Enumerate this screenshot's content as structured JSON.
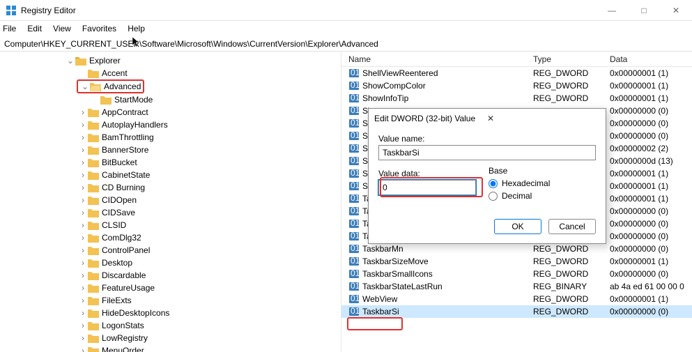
{
  "window": {
    "title": "Registry Editor",
    "controls": {
      "min": "—",
      "max": "□",
      "close": "✕"
    }
  },
  "menu": {
    "file": "File",
    "edit": "Edit",
    "view": "View",
    "favorites": "Favorites",
    "help": "Help"
  },
  "address": "Computer\\HKEY_CURRENT_USER\\Software\\Microsoft\\Windows\\CurrentVersion\\Explorer\\Advanced",
  "tree": {
    "root": "Explorer",
    "accent": "Accent",
    "advanced": "Advanced",
    "startmode": "StartMode",
    "items": [
      "AppContract",
      "AutoplayHandlers",
      "BamThrottling",
      "BannerStore",
      "BitBucket",
      "CabinetState",
      "CD Burning",
      "CIDOpen",
      "CIDSave",
      "CLSID",
      "ComDlg32",
      "ControlPanel",
      "Desktop",
      "Discardable",
      "FeatureUsage",
      "FileExts",
      "HideDesktopIcons",
      "LogonStats",
      "LowRegistry",
      "MenuOrder"
    ]
  },
  "columns": {
    "name": "Name",
    "type": "Type",
    "data": "Data"
  },
  "rows": [
    {
      "n": "ShellViewReentered",
      "t": "REG_DWORD",
      "d": "0x00000001 (1)"
    },
    {
      "n": "ShowCompColor",
      "t": "REG_DWORD",
      "d": "0x00000001 (1)"
    },
    {
      "n": "ShowInfoTip",
      "t": "REG_DWORD",
      "d": "0x00000001 (1)"
    },
    {
      "n": "Sho",
      "t": "",
      "d": "0x00000000 (0)"
    },
    {
      "n": "Sho",
      "t": "",
      "d": "0x00000000 (0)"
    },
    {
      "n": "Sho",
      "t": "",
      "d": "0x00000000 (0)"
    },
    {
      "n": "Start",
      "t": "",
      "d": "0x00000002 (2)"
    },
    {
      "n": "Start",
      "t": "",
      "d": "0x0000000d (13)"
    },
    {
      "n": "Start",
      "t": "",
      "d": "0x00000001 (1)"
    },
    {
      "n": "Start",
      "t": "",
      "d": "0x00000001 (1)"
    },
    {
      "n": "Task",
      "t": "",
      "d": "0x00000001 (1)"
    },
    {
      "n": "Task",
      "t": "",
      "d": "0x00000000 (0)"
    },
    {
      "n": "Task",
      "t": "",
      "d": "0x00000000 (0)"
    },
    {
      "n": "TaskbarGlomLevel",
      "t": "REG_DWORD",
      "d": "0x00000000 (0)"
    },
    {
      "n": "TaskbarMn",
      "t": "REG_DWORD",
      "d": "0x00000000 (0)"
    },
    {
      "n": "TaskbarSizeMove",
      "t": "REG_DWORD",
      "d": "0x00000001 (1)"
    },
    {
      "n": "TaskbarSmallIcons",
      "t": "REG_DWORD",
      "d": "0x00000000 (0)"
    },
    {
      "n": "TaskbarStateLastRun",
      "t": "REG_BINARY",
      "d": "ab 4a ed 61 00 00 0"
    },
    {
      "n": "WebView",
      "t": "REG_DWORD",
      "d": "0x00000001 (1)"
    },
    {
      "n": "TaskbarSi",
      "t": "REG_DWORD",
      "d": "0x00000000 (0)"
    }
  ],
  "dialog": {
    "title": "Edit DWORD (32-bit) Value",
    "value_name_label": "Value name:",
    "value_name": "TaskbarSi",
    "value_data_label": "Value data:",
    "value_data": "0",
    "base_label": "Base",
    "hex": "Hexadecimal",
    "dec": "Decimal",
    "ok": "OK",
    "cancel": "Cancel",
    "close": "✕"
  }
}
